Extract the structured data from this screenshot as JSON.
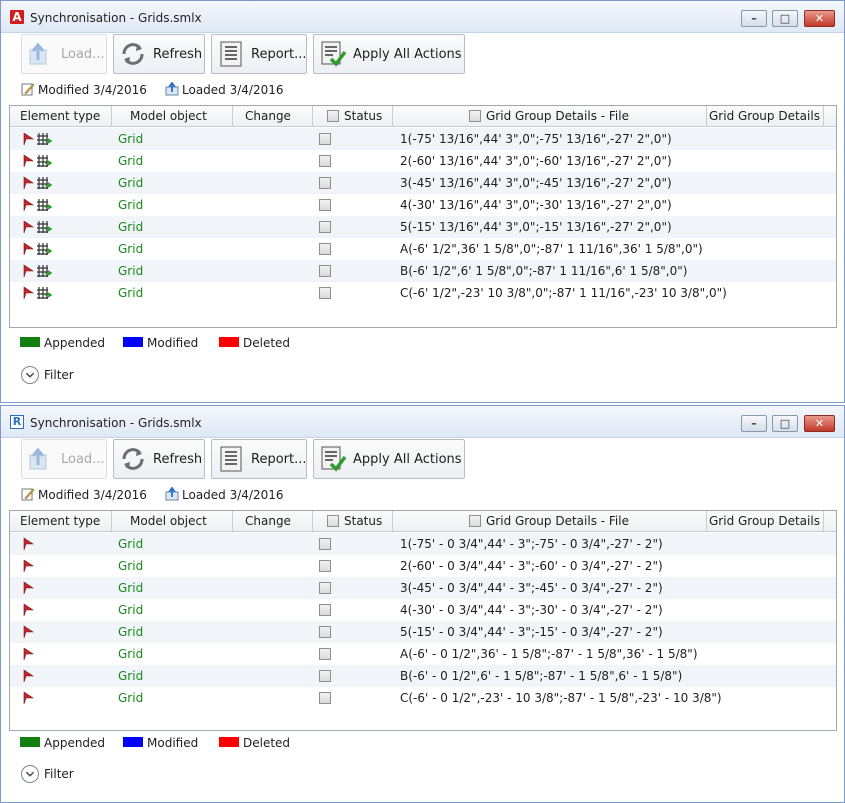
{
  "colors": {
    "appended": "#118011",
    "modified": "#0000ff",
    "deleted": "#ff0000",
    "grid_text": "#1a8a1a"
  },
  "windows": [
    {
      "title": "Synchronisation - Grids.smlx",
      "app_icon": "A",
      "toolbar": {
        "load": "Load...",
        "refresh": "Refresh",
        "report": "Report...",
        "apply": "Apply All Actions"
      },
      "modified": "Modified 3/4/2016",
      "loaded": "Loaded 3/4/2016",
      "columns": [
        "Element type",
        "Model object",
        "Change",
        "Status",
        "Grid Group Details - File",
        "Grid Group Details"
      ],
      "rows": [
        {
          "model_object": "Grid",
          "details_file": "1(-75' 13/16\",44' 3\",0\";-75' 13/16\",-27' 2\",0\")"
        },
        {
          "model_object": "Grid",
          "details_file": "2(-60' 13/16\",44' 3\",0\";-60' 13/16\",-27' 2\",0\")"
        },
        {
          "model_object": "Grid",
          "details_file": "3(-45' 13/16\",44' 3\",0\";-45' 13/16\",-27' 2\",0\")"
        },
        {
          "model_object": "Grid",
          "details_file": "4(-30' 13/16\",44' 3\",0\";-30' 13/16\",-27' 2\",0\")"
        },
        {
          "model_object": "Grid",
          "details_file": "5(-15' 13/16\",44' 3\",0\";-15' 13/16\",-27' 2\",0\")"
        },
        {
          "model_object": "Grid",
          "details_file": "A(-6' 1/2\",36' 1 5/8\",0\";-87' 1 11/16\",36' 1 5/8\",0\")"
        },
        {
          "model_object": "Grid",
          "details_file": "B(-6' 1/2\",6' 1 5/8\",0\";-87' 1 11/16\",6' 1 5/8\",0\")"
        },
        {
          "model_object": "Grid",
          "details_file": "C(-6' 1/2\",-23' 10 3/8\",0\";-87' 1 11/16\",-23' 10 3/8\",0\")"
        }
      ],
      "legend": {
        "appended": "Appended",
        "modified": "Modified",
        "deleted": "Deleted"
      },
      "filter": "Filter"
    },
    {
      "title": "Synchronisation - Grids.smlx",
      "app_icon": "R",
      "toolbar": {
        "load": "Load...",
        "refresh": "Refresh",
        "report": "Report...",
        "apply": "Apply All Actions"
      },
      "modified": "Modified 3/4/2016",
      "loaded": "Loaded 3/4/2016",
      "columns": [
        "Element type",
        "Model object",
        "Change",
        "Status",
        "Grid Group Details - File",
        "Grid Group Details"
      ],
      "rows": [
        {
          "model_object": "Grid",
          "details_file": "1(-75' - 0 3/4\",44' - 3\";-75' - 0 3/4\",-27' - 2\")"
        },
        {
          "model_object": "Grid",
          "details_file": "2(-60' - 0 3/4\",44' - 3\";-60' - 0 3/4\",-27' - 2\")"
        },
        {
          "model_object": "Grid",
          "details_file": "3(-45' - 0 3/4\",44' - 3\";-45' - 0 3/4\",-27' - 2\")"
        },
        {
          "model_object": "Grid",
          "details_file": "4(-30' - 0 3/4\",44' - 3\";-30' - 0 3/4\",-27' - 2\")"
        },
        {
          "model_object": "Grid",
          "details_file": "5(-15' - 0 3/4\",44' - 3\";-15' - 0 3/4\",-27' - 2\")"
        },
        {
          "model_object": "Grid",
          "details_file": "A(-6' - 0 1/2\",36' - 1 5/8\";-87' - 1 5/8\",36' - 1 5/8\")"
        },
        {
          "model_object": "Grid",
          "details_file": "B(-6' - 0 1/2\",6' - 1 5/8\";-87' - 1 5/8\",6' - 1 5/8\")"
        },
        {
          "model_object": "Grid",
          "details_file": "C(-6' - 0 1/2\",-23' - 10 3/8\";-87' - 1 5/8\",-23' - 10 3/8\")"
        }
      ],
      "legend": {
        "appended": "Appended",
        "modified": "Modified",
        "deleted": "Deleted"
      },
      "filter": "Filter"
    }
  ]
}
